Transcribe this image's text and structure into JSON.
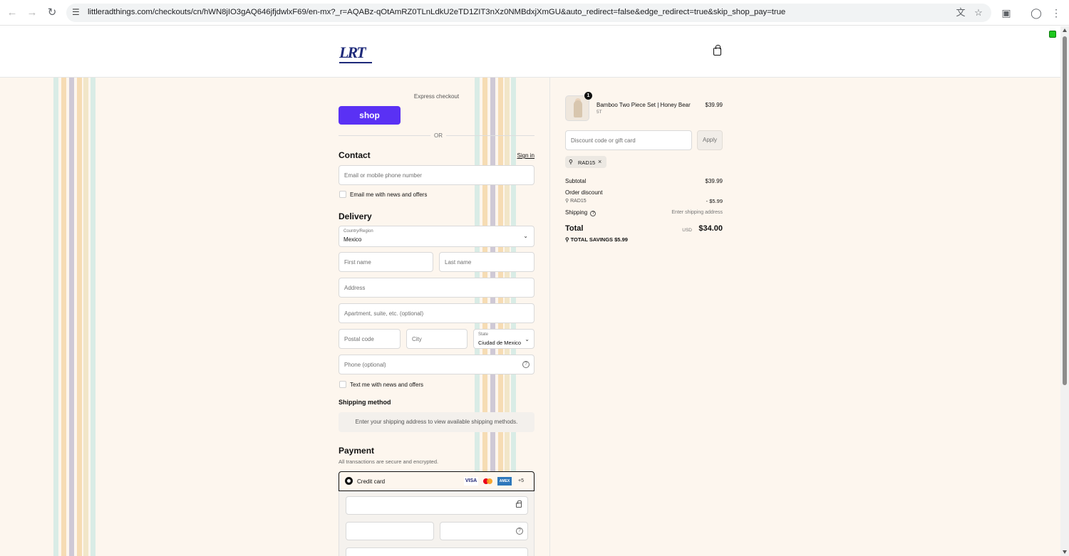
{
  "browser": {
    "url": "littleradthings.com/checkouts/cn/hWN8jIO3gAQ646jfjdwlxF69/en-mx?_r=AQABz-qOtAmRZ0TLnLdkU2eTD1ZIT3nXz0NMBdxjXmGU&auto_redirect=false&edge_redirect=true&skip_shop_pay=true"
  },
  "header": {
    "logo_text": "LRT"
  },
  "express": {
    "label": "Express checkout",
    "shop_label": "shop",
    "or_label": "OR"
  },
  "contact": {
    "title": "Contact",
    "signin": "Sign in",
    "email_placeholder": "Email or mobile phone number",
    "news_label": "Email me with news and offers"
  },
  "delivery": {
    "title": "Delivery",
    "country_label": "Country/Region",
    "country_value": "Mexico",
    "first_name_placeholder": "First name",
    "last_name_placeholder": "Last name",
    "address_placeholder": "Address",
    "apartment_placeholder": "Apartment, suite, etc. (optional)",
    "postal_placeholder": "Postal code",
    "city_placeholder": "City",
    "state_label": "State",
    "state_value": "Ciudad de Mexico",
    "phone_placeholder": "Phone (optional)",
    "text_label": "Text me with news and offers"
  },
  "shipping_method": {
    "title": "Shipping method",
    "note": "Enter your shipping address to view available shipping methods."
  },
  "payment": {
    "title": "Payment",
    "subtitle": "All transactions are secure and encrypted.",
    "credit_card_label": "Credit card",
    "cards": [
      "VISA",
      "",
      "AMEX",
      "+5"
    ]
  },
  "summary": {
    "item_name": "Bamboo Two Piece Set | Honey Bear",
    "item_variant": "5T",
    "item_price": "$39.99",
    "item_qty": "1",
    "discount_placeholder": "Discount code or gift card",
    "apply_label": "Apply",
    "applied_code": "RAD15",
    "subtotal_label": "Subtotal",
    "subtotal_value": "$39.99",
    "order_discount_label": "Order discount",
    "discount_code": "RAD15",
    "discount_value": "- $5.99",
    "shipping_label": "Shipping",
    "shipping_value": "Enter shipping address",
    "total_label": "Total",
    "currency": "USD",
    "total_value": "$34.00",
    "savings_label": "TOTAL SAVINGS",
    "savings_value": "$5.99"
  },
  "colors": {
    "shop_pay": "#5a31f4",
    "background": "#fdf6ee",
    "logo": "#1e2a7a"
  }
}
